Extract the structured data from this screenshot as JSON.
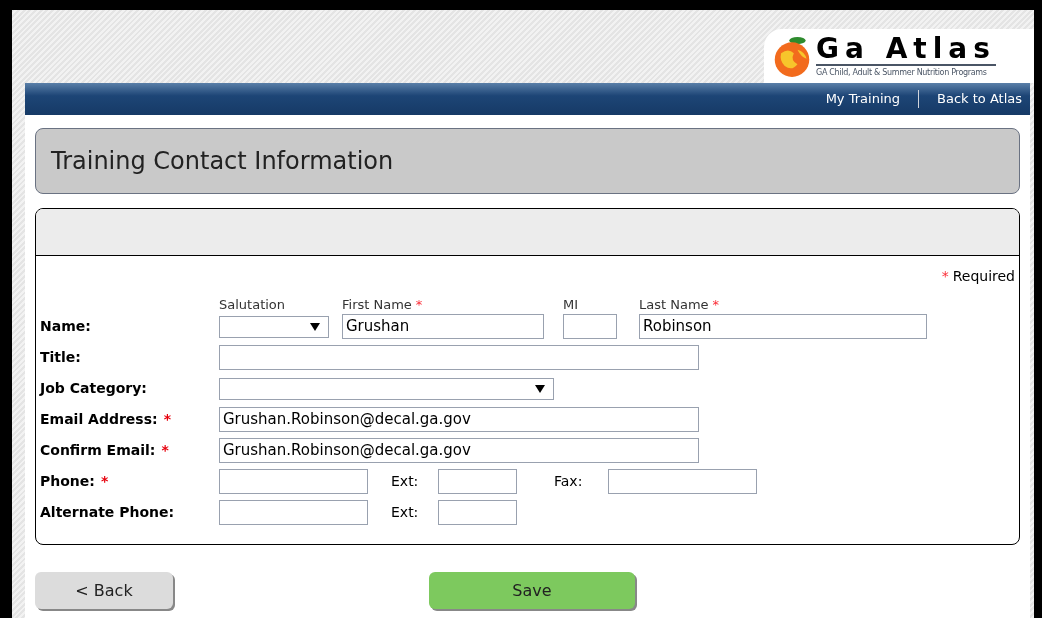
{
  "header": {
    "logo": {
      "title": "Ga Atlas",
      "subtitle": "GA Child, Adult & Summer Nutrition Programs"
    },
    "nav_links": [
      "My Training",
      "Back to Atlas"
    ]
  },
  "page_title": "Training Contact Information",
  "required_note": {
    "mark": "*",
    "text": "Required"
  },
  "name_row": {
    "label": "Name:",
    "fields": [
      {
        "kind": "select",
        "label": "Salutation"
      },
      {
        "kind": "text",
        "label": "First Name",
        "mark": "*",
        "value": "Grushan"
      },
      {
        "kind": "text",
        "label": "MI"
      },
      {
        "kind": "text",
        "label": "Last Name",
        "mark": "*",
        "value": "Robinson"
      }
    ]
  },
  "rows": [
    {
      "kind": "text",
      "label": "Title:"
    },
    {
      "kind": "select",
      "label": "Job Category:"
    },
    {
      "kind": "text",
      "label": "Email Address:",
      "mark": "*",
      "value": "Grushan.Robinson@decal.ga.gov"
    },
    {
      "kind": "text",
      "label": "Confirm Email:",
      "mark": "*",
      "value": "Grushan.Robinson@decal.ga.gov"
    },
    {
      "kind": "phone",
      "label": "Phone:",
      "mark": "*",
      "ext_label": "Ext:",
      "fax_label": "Fax:"
    },
    {
      "kind": "phone",
      "label": "Alternate Phone:",
      "ext_label": "Ext:"
    }
  ],
  "buttons": {
    "back": "< Back",
    "save": "Save"
  }
}
